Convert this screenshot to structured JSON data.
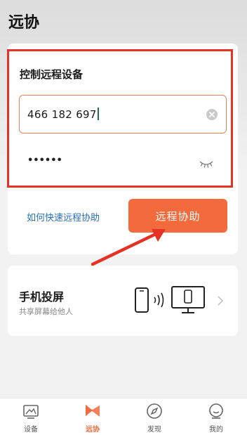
{
  "app": {
    "title": "远协"
  },
  "control": {
    "title": "控制远程设备",
    "device_id": "466 182 697",
    "password_masked": "••••••"
  },
  "actions": {
    "help_link": "如何快速远程协助",
    "assist_button": "远程协助"
  },
  "screen_cast": {
    "title": "手机投屏",
    "subtitle": "共享屏幕给他人"
  },
  "tabs": [
    {
      "label": "设备",
      "icon": "device-icon"
    },
    {
      "label": "远协",
      "icon": "remote-assist-icon",
      "active": true
    },
    {
      "label": "发现",
      "icon": "compass-icon"
    },
    {
      "label": "我的",
      "icon": "profile-icon"
    }
  ],
  "colors": {
    "accent": "#f36a3c",
    "link": "#2a6fb5",
    "annotation_red": "#e53224"
  }
}
